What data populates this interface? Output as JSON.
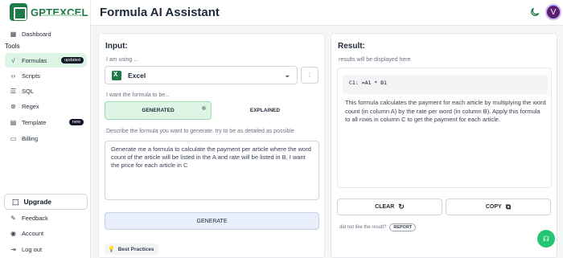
{
  "brand": {
    "name": "GPTEXCEL"
  },
  "header": {
    "title": "Formula AI Assistant",
    "avatar_initial": "V"
  },
  "sidebar": {
    "items": [
      {
        "label": "Dashboard",
        "icon": "dashboard-icon"
      },
      {
        "label": "Formulas",
        "icon": "formula-icon",
        "badge": "updated",
        "active": true
      },
      {
        "label": "Scripts",
        "icon": "code-icon"
      },
      {
        "label": "SQL",
        "icon": "database-icon"
      },
      {
        "label": "Regex",
        "icon": "regex-icon"
      },
      {
        "label": "Template",
        "icon": "template-icon",
        "badge": "new"
      },
      {
        "label": "Billing",
        "icon": "billing-icon"
      }
    ],
    "section_label": "Tools",
    "upgrade_label": "Upgrade",
    "bottom_items": [
      {
        "label": "Feedback",
        "icon": "feedback-icon"
      },
      {
        "label": "Account",
        "icon": "account-icon"
      },
      {
        "label": "Log out",
        "icon": "logout-icon"
      }
    ]
  },
  "input_panel": {
    "title": "Input:",
    "using_label": "I am using ...",
    "app_selected": "Excel",
    "want_label": "I want the formula to be...",
    "tabs": [
      "GENERATED",
      "EXPLAINED"
    ],
    "describe_label": "Describe the formula you want to generate. try to be as detailed as possible",
    "prompt_text": "Generate me a formula to calculate the payment per article where the word count of the article will be listed in the A and rate will be listed in B, I want the price for each article in C",
    "generate_label": "GENERATE",
    "best_practices_label": "Best Practices"
  },
  "result_panel": {
    "title": "Result:",
    "hint": "results will be displayed here",
    "code": "C1: =A1 * B1",
    "explanation": "This formula calculates the payment for each article by multiplying the word count (in column A) by the rate per word (in column B). Apply this formula to all rows in column C to get the payment for each article.",
    "clear_label": "CLEAR",
    "copy_label": "COPY",
    "dislike_text": "did not like the result?",
    "report_label": "REPORT"
  },
  "colors": {
    "accent_green": "#1e7a46",
    "active_bg": "#dcf5e5",
    "help_green": "#22c573"
  }
}
